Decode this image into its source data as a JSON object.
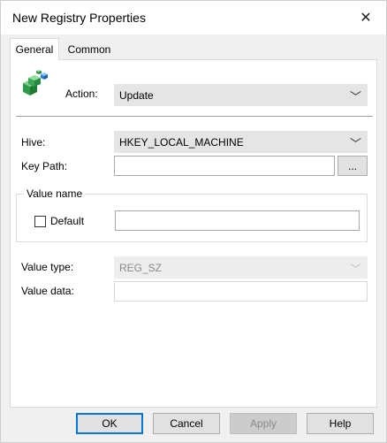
{
  "window": {
    "title": "New Registry Properties",
    "close_glyph": "✕"
  },
  "tabs": [
    {
      "label": "General",
      "active": true
    },
    {
      "label": "Common",
      "active": false
    }
  ],
  "general": {
    "icon": "registry-cubes-icon",
    "action": {
      "label": "Action:",
      "value": "Update"
    },
    "hive": {
      "label": "Hive:",
      "value": "HKEY_LOCAL_MACHINE"
    },
    "key_path": {
      "label": "Key Path:",
      "value": "",
      "browse_label": "..."
    },
    "value_name": {
      "legend": "Value name",
      "default_label": "Default",
      "default_checked": false,
      "value": ""
    },
    "value_type": {
      "label": "Value type:",
      "value": "REG_SZ",
      "disabled": true
    },
    "value_data": {
      "label": "Value data:",
      "value": ""
    }
  },
  "buttons": {
    "ok": "OK",
    "cancel": "Cancel",
    "apply": "Apply",
    "help": "Help"
  },
  "colors": {
    "accent": "#0078d7",
    "icon_green": "#3aa655",
    "icon_blue": "#2a7fd4"
  }
}
